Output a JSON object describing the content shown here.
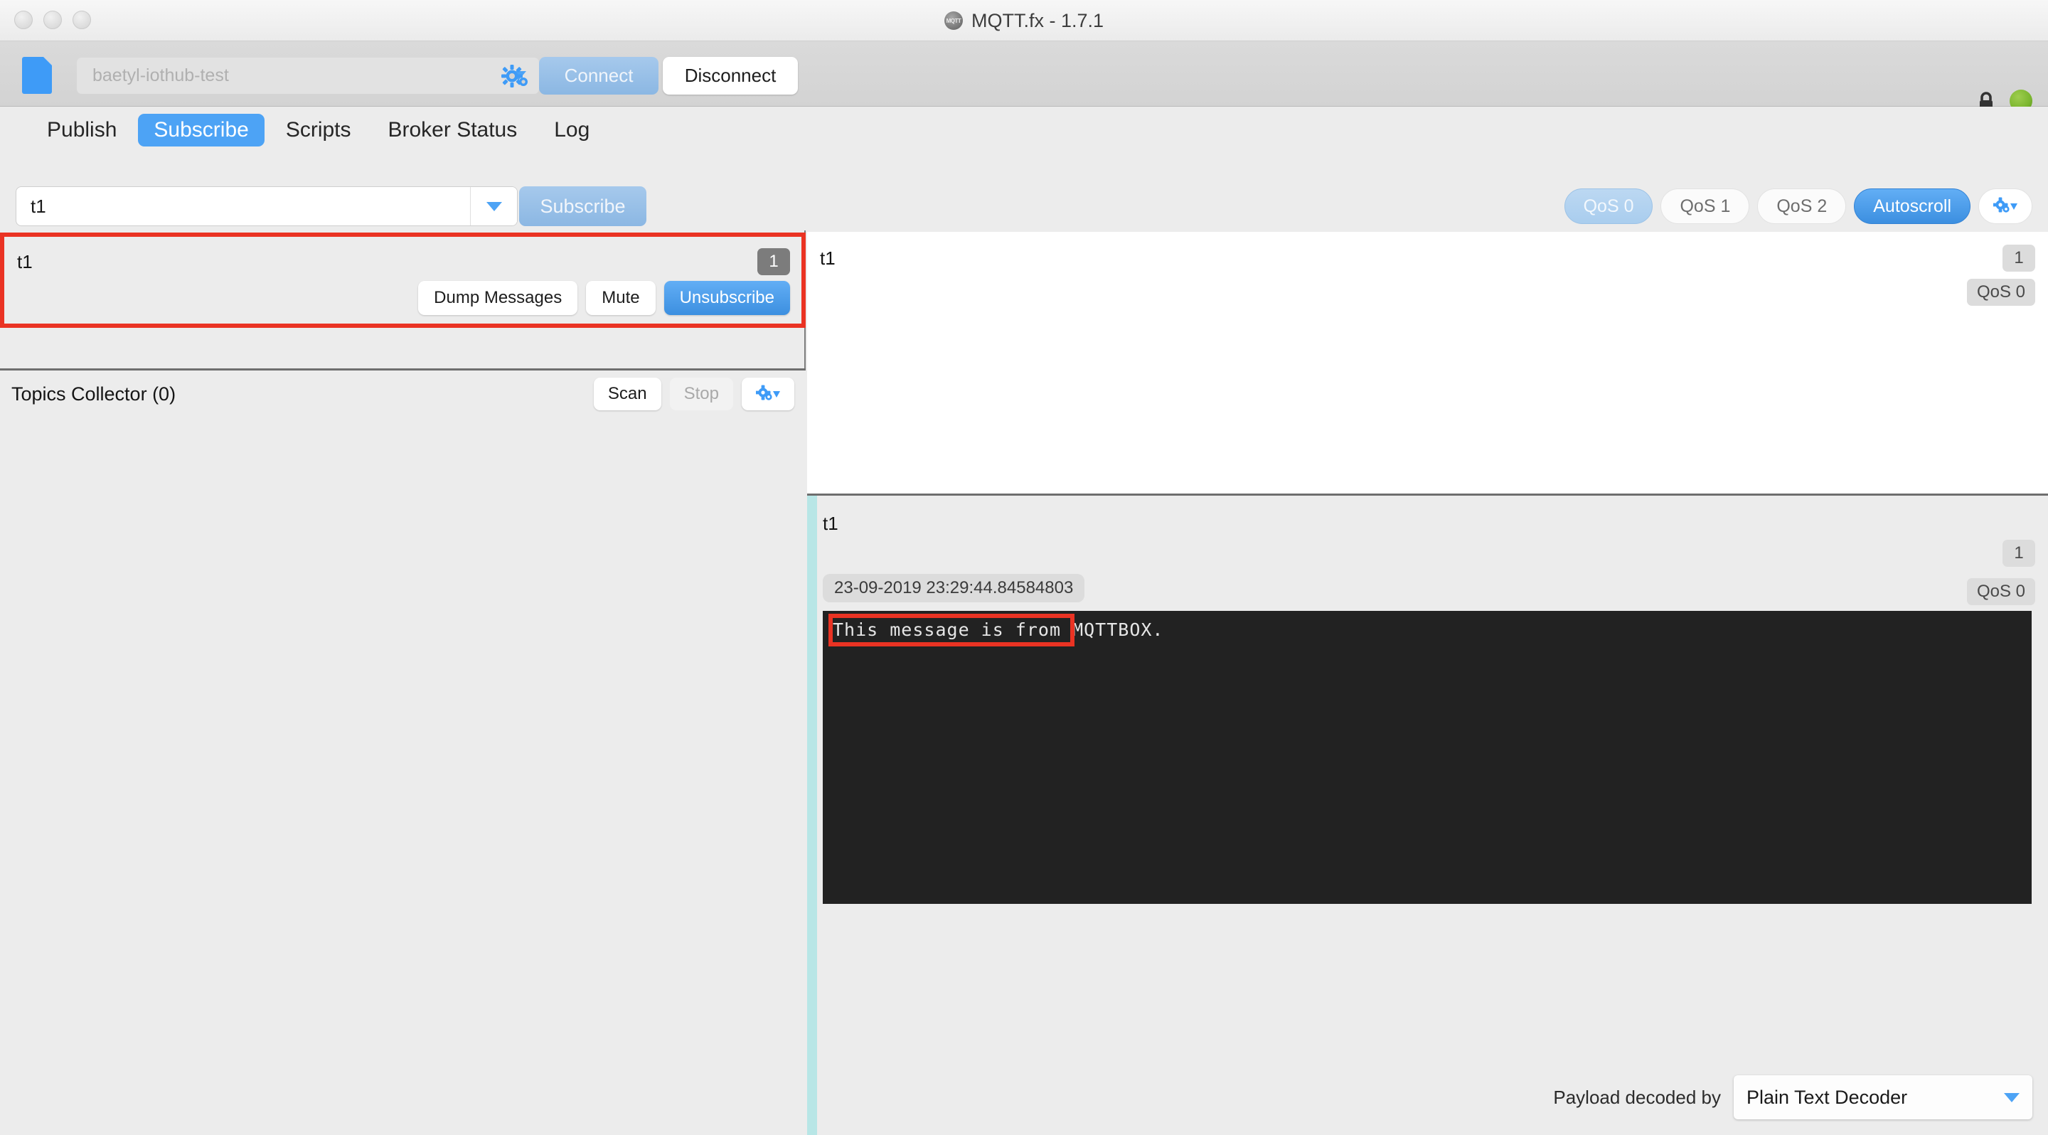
{
  "window": {
    "title": "MQTT.fx - 1.7.1",
    "logo_text": "MQTT",
    "controls": [
      "close",
      "minimize",
      "zoom"
    ]
  },
  "toolbar": {
    "connection_profile": "baetyl-iothub-test",
    "gear_icon": "gear-icon",
    "connect_label": "Connect",
    "disconnect_label": "Disconnect",
    "lock_icon": "lock-icon",
    "status_indicator_color": "#7ab52e"
  },
  "tabs": [
    {
      "label": "Publish",
      "active": false
    },
    {
      "label": "Subscribe",
      "active": true
    },
    {
      "label": "Scripts",
      "active": false
    },
    {
      "label": "Broker Status",
      "active": false
    },
    {
      "label": "Log",
      "active": false
    }
  ],
  "subscribe_bar": {
    "topic_value": "t1",
    "topic_placeholder": "Topic",
    "subscribe_label": "Subscribe",
    "qos_options": [
      {
        "label": "QoS 0",
        "selected": true
      },
      {
        "label": "QoS 1",
        "selected": false
      },
      {
        "label": "QoS 2",
        "selected": false
      }
    ],
    "autoscroll_label": "Autoscroll",
    "autoscroll_active": true,
    "options_icon": "gear-dropdown-icon"
  },
  "subscription": {
    "topic": "t1",
    "count": "1",
    "dump_label": "Dump Messages",
    "mute_label": "Mute",
    "unsubscribe_label": "Unsubscribe"
  },
  "topics_collector": {
    "title": "Topics Collector (0)",
    "scan_label": "Scan",
    "stop_label": "Stop",
    "options_icon": "gear-dropdown-icon"
  },
  "message_list": [
    {
      "topic": "t1",
      "count": "1",
      "qos": "QoS 0"
    }
  ],
  "message_detail": {
    "topic": "t1",
    "count": "1",
    "qos": "QoS 0",
    "timestamp": "23-09-2019 23:29:44.84584803",
    "payload": "This message is from MQTTBOX.",
    "decoder_label": "Payload decoded by",
    "decoder_value": "Plain Text Decoder"
  },
  "colors": {
    "accent_blue": "#4da3f5",
    "highlight_red": "#ea3323",
    "detail_accent": "#b8e6e6",
    "payload_bg": "#222222"
  }
}
